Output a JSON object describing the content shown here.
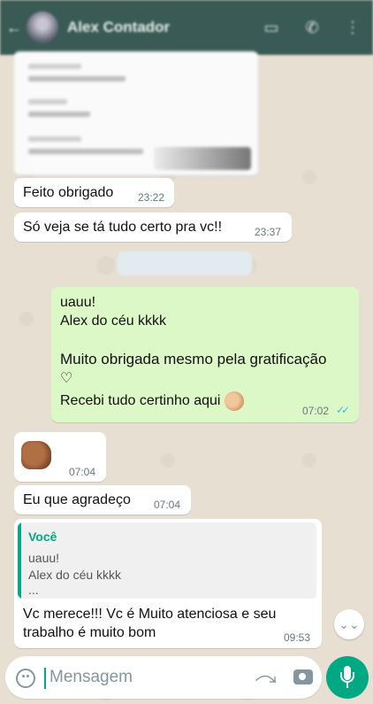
{
  "header": {
    "contact_name": "Alex Contador",
    "back_icon": "arrow-left-icon",
    "video_icon": "video-call-icon",
    "call_icon": "phone-icon",
    "menu_icon": "more-vert-icon"
  },
  "messages": [
    {
      "direction": "in",
      "text": "Feito obrigado",
      "time": "23:22"
    },
    {
      "direction": "in",
      "text": "Só veja se tá tudo certo pra vc!!",
      "time": "23:37"
    },
    {
      "direction": "out",
      "lines": [
        "uauu!",
        "Alex do céu kkkk",
        "",
        "Muito obrigada mesmo pela gratificação",
        "♡",
        "Recebi tudo certinho aqui"
      ],
      "time": "07:02",
      "status": "read"
    },
    {
      "direction": "in",
      "emoji": "fist-bump",
      "time": "07:04"
    },
    {
      "direction": "in",
      "text": "Eu que agradeço",
      "time": "07:04"
    },
    {
      "direction": "in",
      "quote": {
        "author": "Você",
        "lines": [
          "uauu!",
          "Alex do céu kkkk",
          "..."
        ]
      },
      "lines": [
        "Vc merece!!! Vc é Muito atenciosa e seu",
        "trabalho é muito bom"
      ],
      "time": "09:53"
    }
  ],
  "composer": {
    "placeholder": "Mensagem"
  },
  "colors": {
    "header": "#3a5a55",
    "outgoing_bubble": "#dcf8c6",
    "incoming_bubble": "#ffffff",
    "accent": "#00a884",
    "read_ticks": "#34b7f1"
  }
}
